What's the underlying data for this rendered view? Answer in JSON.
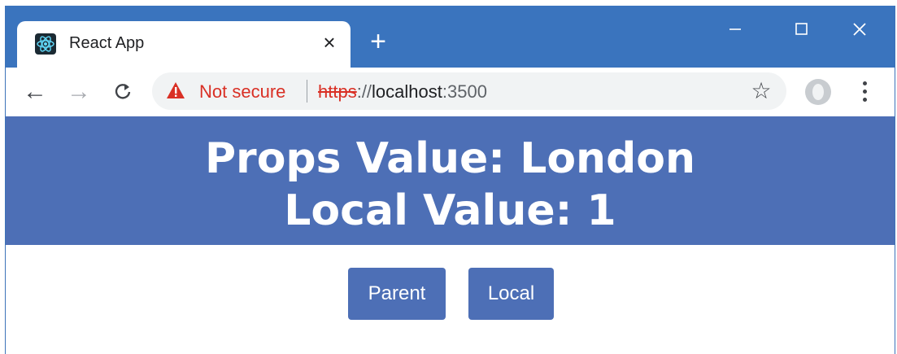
{
  "browser": {
    "tab": {
      "title": "React App",
      "favicon": "react-logo-icon",
      "close_label": "×"
    },
    "new_tab_label": "+",
    "window_controls": {
      "minimize": "minimize-icon",
      "maximize": "maximize-icon",
      "close": "close-icon"
    },
    "toolbar": {
      "back_icon": "←",
      "forward_icon": "→",
      "reload_icon": "C",
      "security_label": "Not secure",
      "url": {
        "scheme": "https",
        "separator": "://",
        "host": "localhost",
        "port": ":3500"
      },
      "star_icon": "☆"
    },
    "colors": {
      "titlebar": "#3a74be",
      "warning": "#d93025",
      "omnibox": "#f1f3f4"
    }
  },
  "page": {
    "heading_props": "Props Value: London",
    "heading_local": "Local Value: 1",
    "buttons": {
      "parent": "Parent",
      "local": "Local"
    },
    "colors": {
      "primary": "#4d6fb6",
      "text_on_primary": "#ffffff"
    }
  }
}
